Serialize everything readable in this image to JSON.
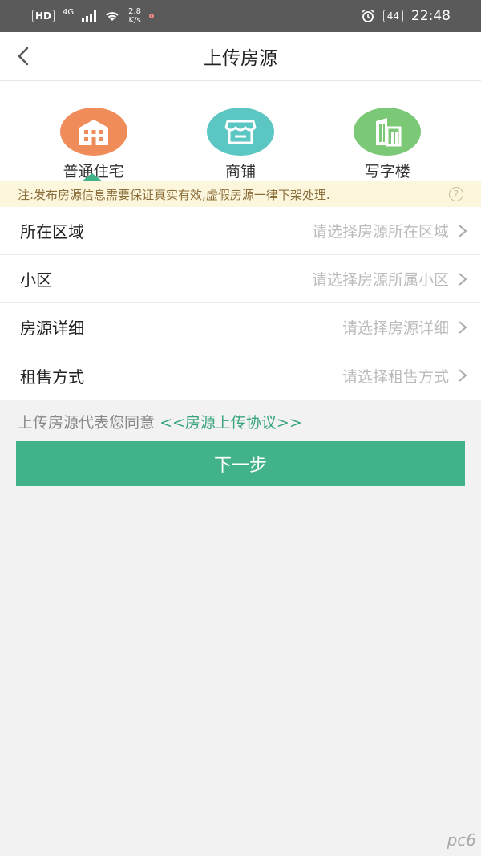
{
  "status_bar": {
    "hd": "HD",
    "network": "4G",
    "speed_value": "2.8",
    "speed_unit": "K/s",
    "battery": "44",
    "time": "22:48"
  },
  "nav": {
    "title": "上传房源"
  },
  "property_types": [
    {
      "label": "普通住宅",
      "color": "#f08c5a",
      "icon": "building-icon",
      "selected": true
    },
    {
      "label": "商铺",
      "color": "#5cc6c3",
      "icon": "shop-icon",
      "selected": false
    },
    {
      "label": "写字楼",
      "color": "#7bc977",
      "icon": "office-building-icon",
      "selected": false
    }
  ],
  "notice": "注:发布房源信息需要保证真实有效,虚假房源一律下架处理.",
  "form": {
    "rows": [
      {
        "label": "所在区域",
        "placeholder": "请选择房源所在区域"
      },
      {
        "label": "小区",
        "placeholder": "请选择房源所属小区"
      },
      {
        "label": "房源详细",
        "placeholder": "请选择房源详细"
      },
      {
        "label": "租售方式",
        "placeholder": "请选择租售方式"
      }
    ]
  },
  "agreement": {
    "prefix": "上传房源代表您同意",
    "link": "<<房源上传协议>>"
  },
  "next_button": "下一步",
  "colors": {
    "accent": "#42b389",
    "notice_bg": "#fcf7dc"
  },
  "watermark": "pc6"
}
